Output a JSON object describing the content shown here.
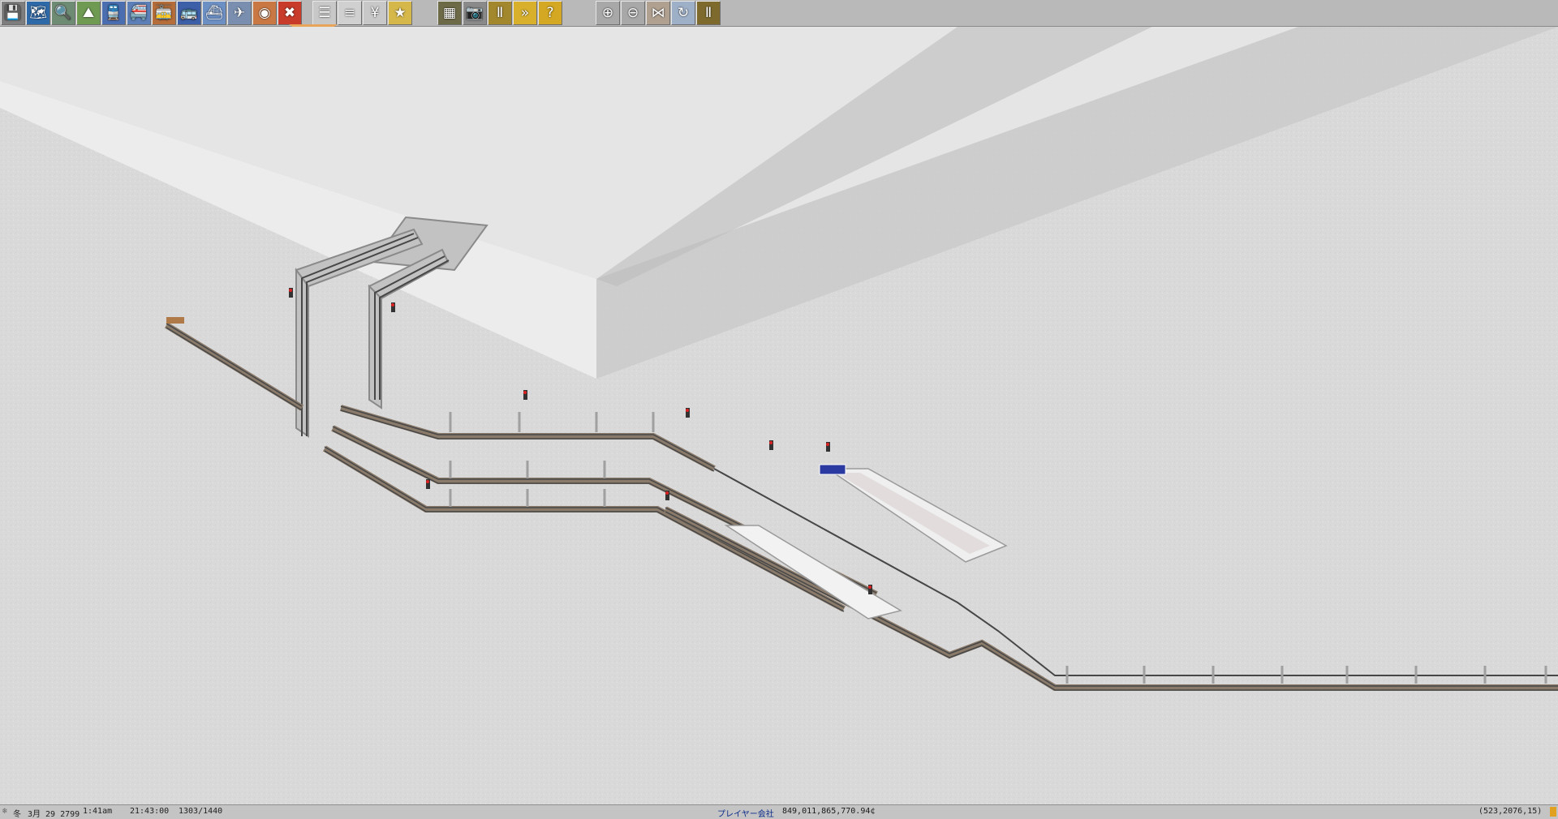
{
  "toolbar": {
    "groups": [
      [
        {
          "name": "save-disk-icon",
          "glyph": "💾",
          "bg": "#7e7e7e"
        },
        {
          "name": "map-icon",
          "glyph": "🗺",
          "bg": "#2f6aa8"
        },
        {
          "name": "magnifier-icon",
          "glyph": "🔍",
          "bg": "#6e8c74"
        },
        {
          "name": "terrain-slope-icon",
          "glyph": "⛰",
          "bg": "#6f9a52"
        },
        {
          "name": "train-tools-icon",
          "glyph": "🚆",
          "bg": "#4b6eb0"
        },
        {
          "name": "monorail-tools-icon",
          "glyph": "🚝",
          "bg": "#5d7fb8"
        },
        {
          "name": "tram-tools-icon",
          "glyph": "🚋",
          "bg": "#b56d3a"
        },
        {
          "name": "road-vehicle-tools-icon",
          "glyph": "🚌",
          "bg": "#3d5fa8"
        },
        {
          "name": "ship-tools-icon",
          "glyph": "⛴",
          "bg": "#6c8fc4"
        },
        {
          "name": "airplane-tools-icon",
          "glyph": "✈",
          "bg": "#7a8fb0"
        },
        {
          "name": "special-construction-icon",
          "glyph": "◉",
          "bg": "#c97844"
        },
        {
          "name": "remove-x-icon",
          "glyph": "✖",
          "bg": "#c83a2a"
        }
      ],
      [
        {
          "name": "line-management-icon",
          "glyph": "☰",
          "bg": "#c8c8c8"
        },
        {
          "name": "convoy-list-icon",
          "glyph": "≡",
          "bg": "#d0d0d0"
        },
        {
          "name": "finance-icon",
          "glyph": "¥",
          "bg": "#c8c8c8"
        },
        {
          "name": "player-list-icon",
          "glyph": "★",
          "bg": "#d6b84a"
        }
      ],
      [
        {
          "name": "scenery-icon",
          "glyph": "▦",
          "bg": "#6d6a48"
        },
        {
          "name": "screenshot-camera-icon",
          "glyph": "📷",
          "bg": "#8a8a8a"
        },
        {
          "name": "pause-icon",
          "glyph": "Ⅱ",
          "bg": "#a3872c"
        },
        {
          "name": "fast-forward-icon",
          "glyph": "»",
          "bg": "#d8b02c"
        },
        {
          "name": "help-icon",
          "glyph": "?",
          "bg": "#d4a822"
        }
      ],
      [
        {
          "name": "zoom-in-icon",
          "glyph": "⊕",
          "bg": "#a8a8a8"
        },
        {
          "name": "zoom-out-icon",
          "glyph": "⊖",
          "bg": "#a8a8a8"
        },
        {
          "name": "grid-toggle-icon",
          "glyph": "⋈",
          "bg": "#b0a090"
        },
        {
          "name": "rotate-view-icon",
          "glyph": "↻",
          "bg": "#9eb0c8"
        },
        {
          "name": "pause-toggle-icon",
          "glyph": "Ⅱ",
          "bg": "#7d6a2c"
        }
      ]
    ]
  },
  "status": {
    "weather_glyph": "❄",
    "season": "冬",
    "date": "3月 29 2799",
    "clock": "1:41am",
    "ticks": "21:43:00",
    "fps": "1303/1440",
    "company": "プレイヤー会社",
    "money": "849,011,865,770.94¢",
    "coords": "(523,2076,15)"
  },
  "colors": {
    "ground": "#dadada",
    "raised_top": "#e6e6e6",
    "raised_side": "#bdbdbd",
    "slope": "#c9c9c9",
    "rail": "#474747",
    "ballast": "#8a7a6a",
    "station_label": "#2a3aa0"
  }
}
